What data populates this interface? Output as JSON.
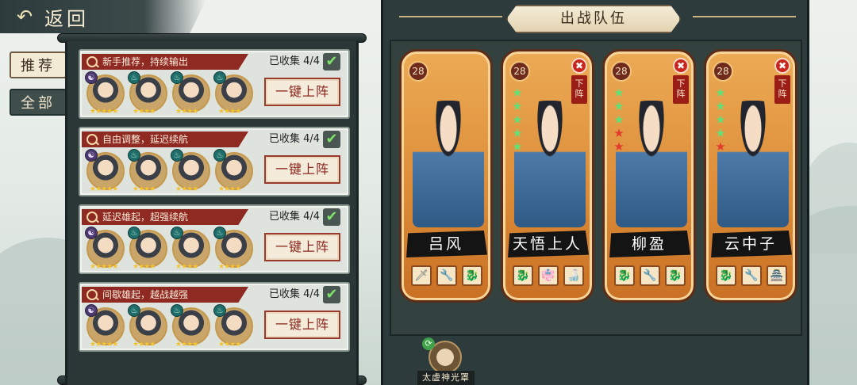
{
  "header": {
    "back_label": "返回"
  },
  "tabs": [
    {
      "label": "推荐",
      "active": true
    },
    {
      "label": "全部",
      "active": false
    }
  ],
  "lineups": [
    {
      "title": "新手推荐，持续输出",
      "collected": "已收集 4/4",
      "button": "一键上阵",
      "members": [
        {
          "elem": "☯",
          "stars": "★★★★★"
        },
        {
          "elem": "♨",
          "stars": "★★★★"
        },
        {
          "elem": "♨",
          "stars": "★★★★"
        },
        {
          "elem": "♨",
          "stars": "★★★★"
        }
      ]
    },
    {
      "title": "自由调整，延迟续航",
      "collected": "已收集 4/4",
      "button": "一键上阵",
      "members": [
        {
          "elem": "☯",
          "stars": "★★★★★"
        },
        {
          "elem": "♨",
          "stars": "★★★★"
        },
        {
          "elem": "♨",
          "stars": "★★★★"
        },
        {
          "elem": "♨",
          "stars": "★★★★"
        }
      ]
    },
    {
      "title": "延迟雄起，超强续航",
      "collected": "已收集 4/4",
      "button": "一键上阵",
      "members": [
        {
          "elem": "☯",
          "stars": "★★★★★"
        },
        {
          "elem": "♨",
          "stars": "★★★★"
        },
        {
          "elem": "♨",
          "stars": "★★★★"
        },
        {
          "elem": "♨",
          "stars": "★★★★"
        }
      ]
    },
    {
      "title": "间歇雄起，越战越强",
      "collected": "已收集 4/4",
      "button": "一键上阵",
      "members": [
        {
          "elem": "☯",
          "stars": "★★★★★"
        },
        {
          "elem": "♨",
          "stars": "★★★★"
        },
        {
          "elem": "♨",
          "stars": "★★★★"
        },
        {
          "elem": "♨",
          "stars": "★★★★"
        }
      ]
    }
  ],
  "team": {
    "title": "出战队伍",
    "heroes": [
      {
        "name": "吕风",
        "level": "28",
        "stars": [],
        "removable": false,
        "equipment": [
          "🗡",
          "🔧",
          "🐉"
        ]
      },
      {
        "name": "天悟上人",
        "level": "28",
        "stars": [
          "green",
          "green",
          "green",
          "green",
          "green"
        ],
        "removable": true,
        "remove_label": "下阵",
        "equipment": [
          "🐉",
          "👘",
          "🍶"
        ]
      },
      {
        "name": "柳盈",
        "level": "28",
        "stars": [
          "green",
          "green",
          "green",
          "red",
          "red"
        ],
        "removable": true,
        "remove_label": "下阵",
        "equipment": [
          "🐉",
          "🔧",
          "🐉"
        ]
      },
      {
        "name": "云中子",
        "level": "28",
        "stars": [
          "green",
          "green",
          "green",
          "green",
          "red"
        ],
        "removable": true,
        "remove_label": "下阵",
        "equipment": [
          "🐉",
          "🔧",
          "🏯"
        ]
      }
    ]
  },
  "artifact": {
    "label": "太虚神光罩"
  }
}
